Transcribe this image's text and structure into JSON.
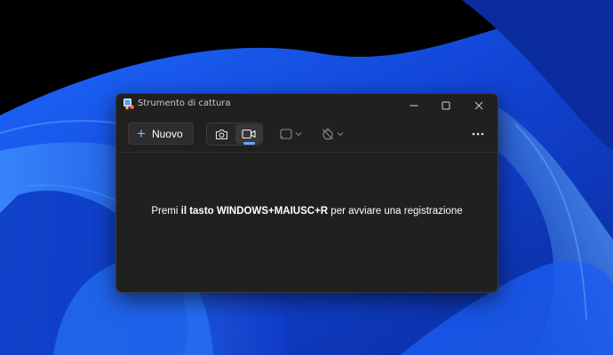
{
  "window": {
    "title": "Strumento di cattura",
    "controls": [
      "minimize-icon",
      "maximize-icon",
      "close-icon"
    ]
  },
  "toolbar": {
    "new_label": "Nuovo",
    "modes": [
      {
        "icon": "camera-icon",
        "active": false
      },
      {
        "icon": "video-camera-icon",
        "active": true
      }
    ],
    "shape_icon": "rectangle-snip-icon",
    "delay_icon": "timer-off-icon",
    "more_icon": "more-dots-icon"
  },
  "message": {
    "prefix": "Premi ",
    "bold": "il tasto WINDOWS+MAIUSC+R",
    "suffix": " per avviare una registrazione"
  },
  "colors": {
    "accent": "#60a8ff",
    "window_bg": "#202020",
    "wallpaper": "#1a56e8"
  }
}
